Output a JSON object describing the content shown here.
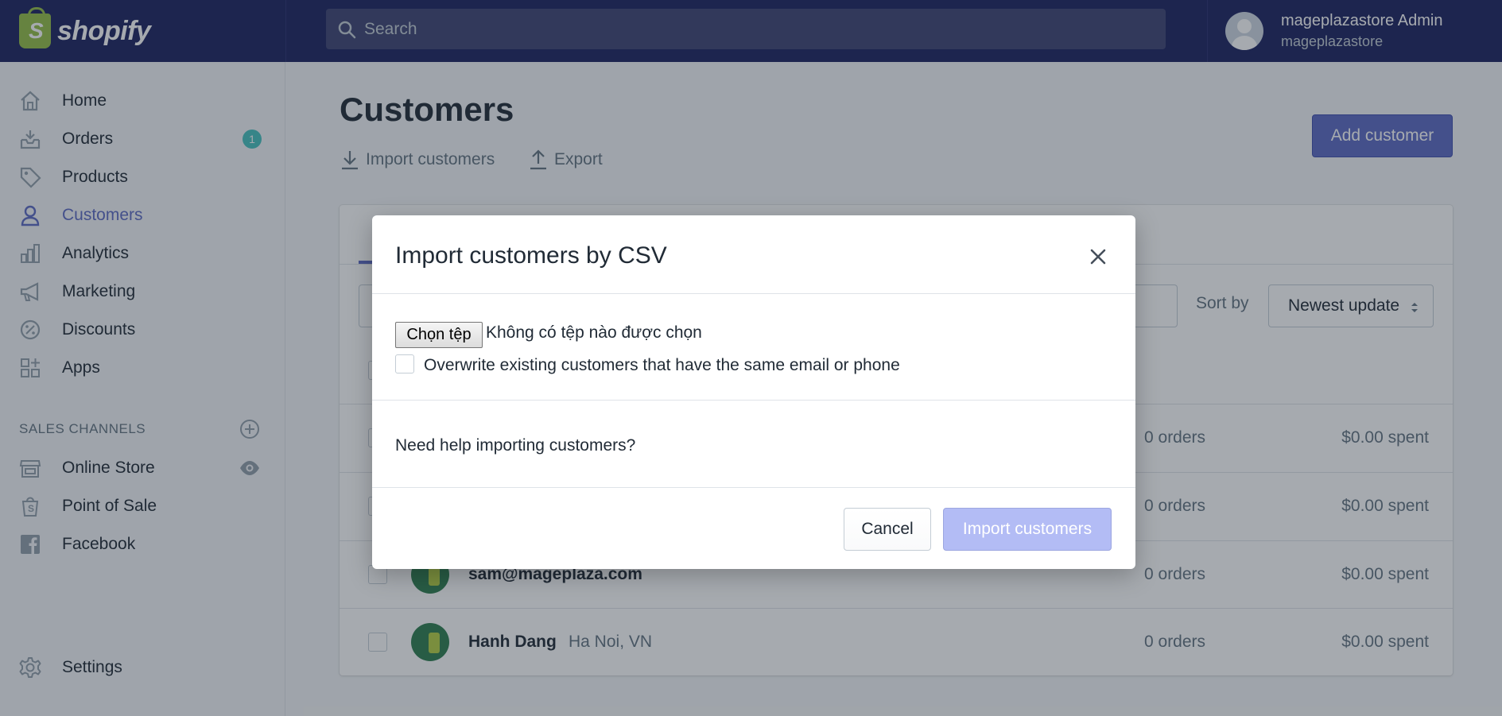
{
  "app": {
    "logo_text": "shopify",
    "logo_glyph": "S"
  },
  "search": {
    "placeholder": "Search"
  },
  "user": {
    "name": "mageplazastore Admin",
    "store": "mageplazastore"
  },
  "sidebar": {
    "items": [
      {
        "label": "Home",
        "icon": "home-icon"
      },
      {
        "label": "Orders",
        "icon": "orders-icon",
        "badge": "1"
      },
      {
        "label": "Products",
        "icon": "tag-icon"
      },
      {
        "label": "Customers",
        "icon": "person-icon",
        "active": true
      },
      {
        "label": "Analytics",
        "icon": "analytics-icon"
      },
      {
        "label": "Marketing",
        "icon": "megaphone-icon"
      },
      {
        "label": "Discounts",
        "icon": "discount-icon"
      },
      {
        "label": "Apps",
        "icon": "apps-icon"
      }
    ],
    "sales_channels_label": "SALES CHANNELS",
    "channels": [
      {
        "label": "Online Store",
        "icon": "store-icon"
      },
      {
        "label": "Point of Sale",
        "icon": "bag-icon"
      },
      {
        "label": "Facebook",
        "icon": "facebook-icon"
      }
    ],
    "settings_label": "Settings"
  },
  "main": {
    "title": "Customers",
    "import_label": "Import customers",
    "export_label": "Export",
    "add_button": "Add customer",
    "sort_label": "Sort by",
    "sort_value": "Newest update",
    "rows": [
      {
        "name": "",
        "location": "",
        "orders": "0 orders",
        "spent": "$0.00 spent"
      },
      {
        "name": "",
        "location": "",
        "orders": "0 orders",
        "spent": "$0.00 spent"
      },
      {
        "name": "sam@mageplaza.com",
        "location": "",
        "orders": "0 orders",
        "spent": "$0.00 spent"
      },
      {
        "name": "Hanh Dang",
        "location": "Ha Noi, VN",
        "orders": "0 orders",
        "spent": "$0.00 spent"
      }
    ]
  },
  "modal": {
    "title": "Import customers by CSV",
    "file_button": "Chọn tệp",
    "file_status": "Không có tệp nào được chọn",
    "overwrite_label": "Overwrite existing customers that have the same email or phone",
    "help_text": "Need help importing customers?",
    "cancel": "Cancel",
    "import": "Import customers"
  },
  "colors": {
    "topbar": "#1c2260",
    "accent": "#5c6ac4",
    "badge": "#47c1bf",
    "import_disabled": "#b3bcf5"
  }
}
